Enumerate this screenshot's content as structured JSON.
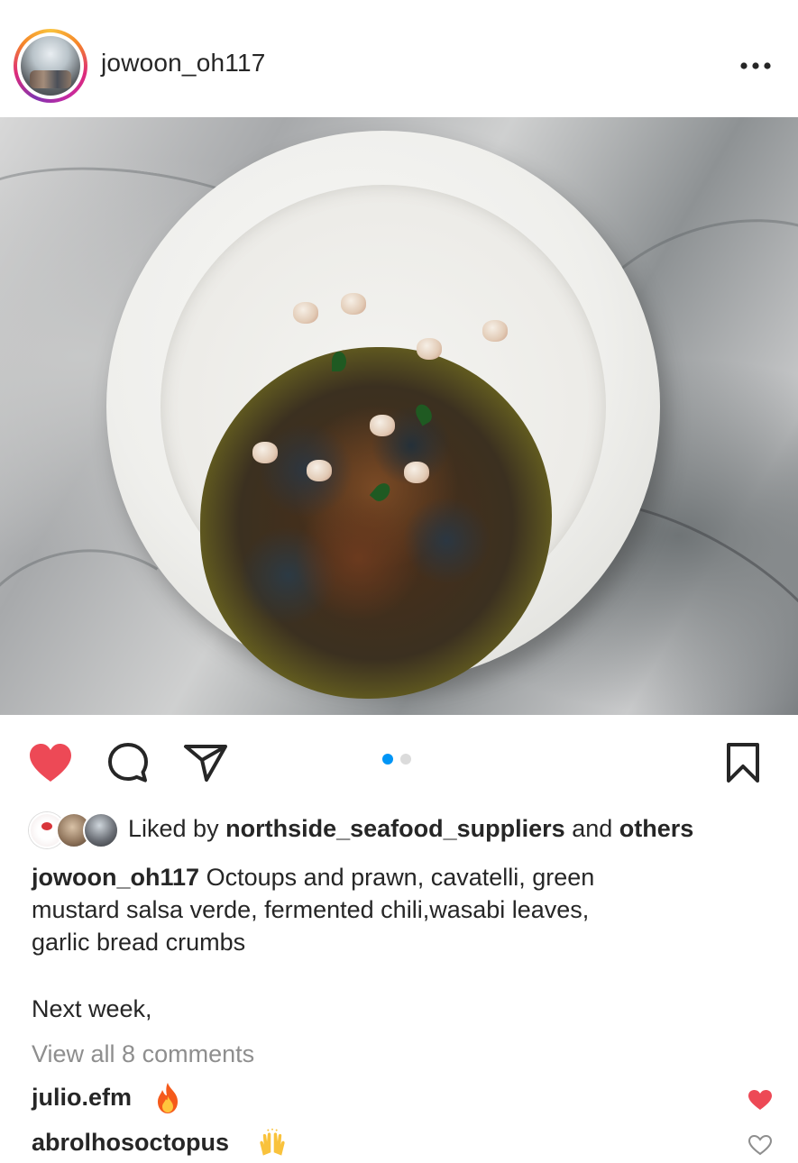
{
  "header": {
    "username": "jowoon_oh117",
    "more_icon": "more-horizontal-icon"
  },
  "post": {
    "image_alt": "Octopus and prawn cavatelli dish",
    "carousel": {
      "current": 1,
      "total": 2
    }
  },
  "actions": {
    "liked": true,
    "like_color": "#ed4956",
    "icons": [
      "heart-icon",
      "comment-icon",
      "share-icon",
      "bookmark-icon"
    ],
    "dot_active_color": "#0095f6",
    "dot_inactive_color": "#dbdbdb"
  },
  "likes": {
    "prefix": "Liked by",
    "top_liker": "northside_seafood_suppliers",
    "connector": "and",
    "others": "others"
  },
  "caption": {
    "username": "jowoon_oh117",
    "line1": "Octoups and prawn, cavatelli, green",
    "line2": "mustard salsa verde, fermented chili,wasabi leaves,",
    "line3": "garlic bread crumbs",
    "extra": "Next week,"
  },
  "comments_link": "View all 8 comments",
  "comments": [
    {
      "username": "julio.efm",
      "emoji": "🔥",
      "liked": true
    },
    {
      "username": "abrolhosoctopus",
      "emoji": "🙌",
      "liked": false
    }
  ]
}
